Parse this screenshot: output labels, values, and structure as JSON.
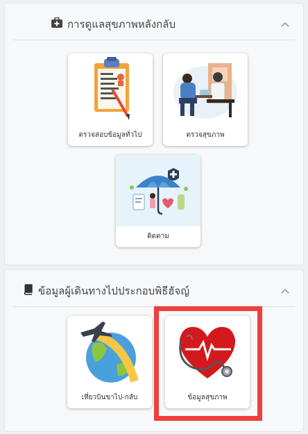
{
  "sections": [
    {
      "title": "การดูแลสุขภาพหลังกลับ",
      "icon": "medical-kit-icon",
      "cards": [
        {
          "label": "ตรวจสอบข้อมูลทั่วไป",
          "icon": "clipboard-checklist-icon"
        },
        {
          "label": "ตรวจสุขภาพ",
          "icon": "doctor-consultation-icon"
        },
        {
          "label": "ติดตาม",
          "icon": "health-protection-umbrella-icon"
        }
      ]
    },
    {
      "title": "ข้อมูลผู้เดินทางไปประกอบพิธีฮัจญ์",
      "icon": "book-icon",
      "cards": [
        {
          "label": "เที่ยวบินขาไป-กลับ",
          "icon": "airplane-globe-icon"
        },
        {
          "label": "ข้อมูลสุขภาพ",
          "icon": "heart-stethoscope-icon"
        }
      ]
    }
  ],
  "colors": {
    "highlight": "#f03f3f",
    "panel_bg": "#f7f8fa",
    "page_bg": "#eef0f3"
  }
}
